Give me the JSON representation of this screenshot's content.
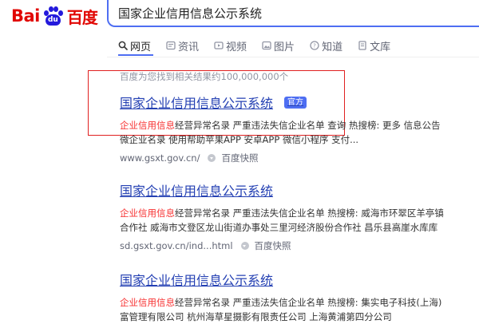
{
  "logo": {
    "bai": "Bai",
    "paw": "du",
    "cn": "百度"
  },
  "search": {
    "query": "国家企业信用信息公示系统"
  },
  "tabs": [
    {
      "label": "网页",
      "icon": "search-icon"
    },
    {
      "label": "资讯",
      "icon": "news-icon"
    },
    {
      "label": "视频",
      "icon": "video-icon"
    },
    {
      "label": "图片",
      "icon": "image-icon"
    },
    {
      "label": "知道",
      "icon": "question-icon"
    },
    {
      "label": "文库",
      "icon": "library-icon"
    }
  ],
  "result_count": "百度为您找到相关结果约100,000,000个",
  "results": [
    {
      "title": "国家企业信用信息公示系统",
      "badge": "官方",
      "desc_hl": "企业信用信息",
      "desc_line1": "经营异常名录 严重违法失信企业名单 查询 热搜榜: 更多 信息公告",
      "desc_line2": "微企业名录 使用帮助苹果APP 安卓APP 微信小程序 支付...",
      "url": "www.gsxt.gov.cn/",
      "snapshot": "百度快照"
    },
    {
      "title": "国家企业信用信息公示系统",
      "desc_hl": "企业信用信息",
      "desc_line1": "经营异常名录 严重违法失信企业名单 热搜榜: 威海市环翠区羊亭镇",
      "desc_line2": "合作社 威海市文登区龙山街道办事处三里河经济股份合作社 昌乐县高崖水库库",
      "url": "sd.gsxt.gov.cn/ind...html",
      "snapshot": "百度快照"
    },
    {
      "title": "国家企业信用信息公示系统",
      "desc_hl": "企业信用信息",
      "desc_line1": "经营异常名录 严重违法失信企业名单 热搜榜: 集实电子科技(上海)",
      "desc_line2": "富管理有限公司 杭州海草星摄影有限责任公司 上海黄浦第四分公司"
    }
  ],
  "colors": {
    "brand_red": "#e10602",
    "brand_blue": "#2319dc",
    "link": "#2440b3",
    "accent": "#4e6ef2",
    "highlight_text": "#f73131",
    "annotation_box": "#e02020"
  }
}
